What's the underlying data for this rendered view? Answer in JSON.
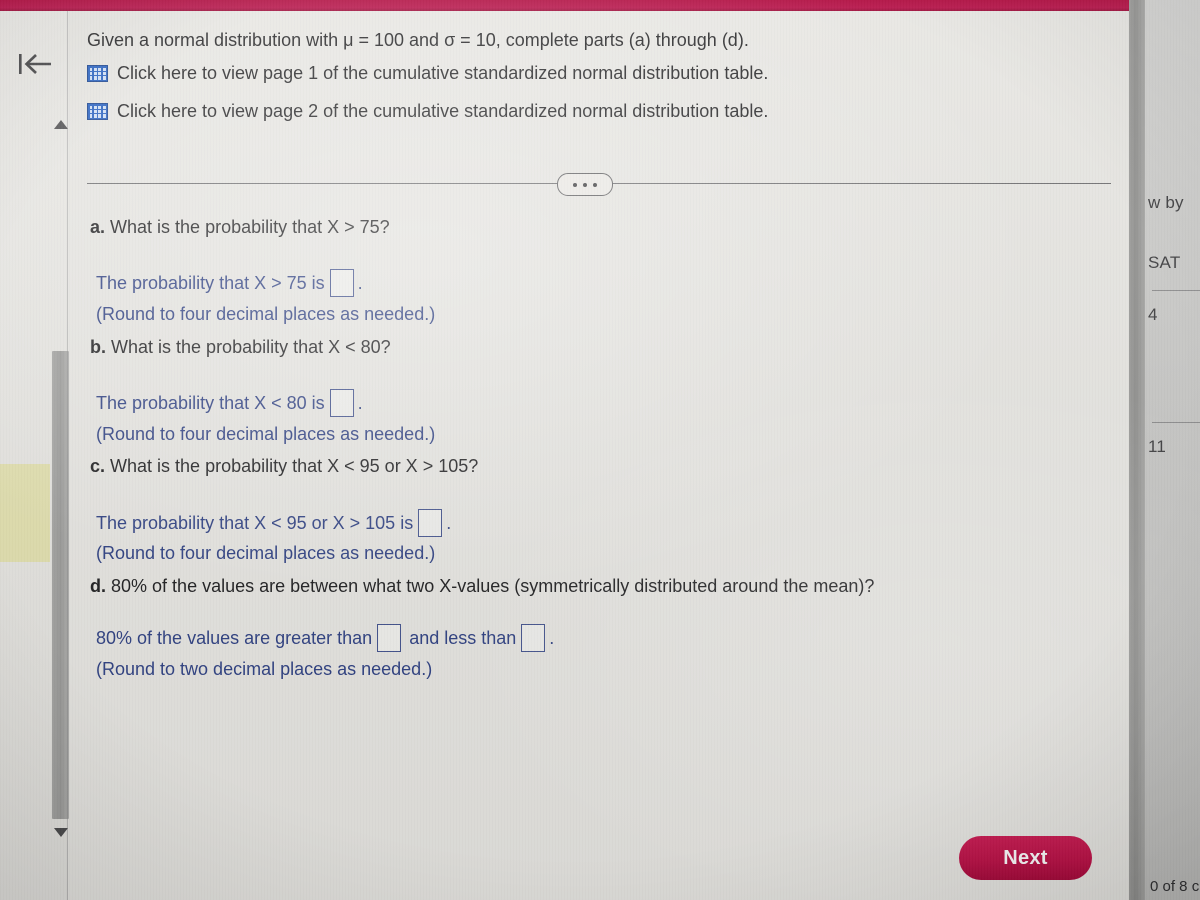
{
  "window": {
    "title_bar_color": "#b3003c",
    "page_background": "#e7e6e2"
  },
  "left_rail": {
    "back_icon": "back-to-start-icon",
    "scrollbar": {
      "up_arrow": "scroll-up-arrow-icon",
      "down_arrow": "scroll-down-arrow-icon"
    }
  },
  "problem": {
    "prompt": "Given a normal distribution with μ = 100 and σ = 10, complete parts (a) through (d).",
    "resource_links": [
      {
        "icon": "table-icon",
        "label": "Click here to view page 1 of the cumulative standardized normal distribution table."
      },
      {
        "icon": "table-icon",
        "label": "Click here to view page 2 of the cumulative standardized normal distribution table."
      }
    ],
    "divider_button": "•••",
    "parts": [
      {
        "letter": "a.",
        "question": "What is the probability that X > 75?",
        "answer_prefix": "The probability that X > 75 is",
        "answer_value": "",
        "answer_suffix": ".",
        "rounding": "(Round to four decimal places as needed.)"
      },
      {
        "letter": "b.",
        "question": "What is the probability that X < 80?",
        "answer_prefix": "The probability that X < 80 is",
        "answer_value": "",
        "answer_suffix": ".",
        "rounding": "(Round to four decimal places as needed.)"
      },
      {
        "letter": "c.",
        "question": "What is the probability that X < 95 or X > 105?",
        "answer_prefix": "The probability that X < 95 or X > 105 is",
        "answer_value": "",
        "answer_suffix": ".",
        "rounding": "(Round to four decimal places as needed.)"
      },
      {
        "letter": "d.",
        "question": "80% of the values are between what two X-values (symmetrically distributed around the mean)?",
        "answer_prefix": "80% of the values are greater than",
        "answer_middle": "and less than",
        "answer_value": "",
        "answer_value_2": "",
        "answer_suffix": ".",
        "rounding": "(Round to two decimal places as needed.)"
      }
    ]
  },
  "footer": {
    "next_label": "Next"
  },
  "background_calendar": {
    "header_fragment": "w by",
    "day_label": "SAT",
    "dates": [
      "4",
      "11"
    ],
    "status": "0 of 8 c"
  }
}
